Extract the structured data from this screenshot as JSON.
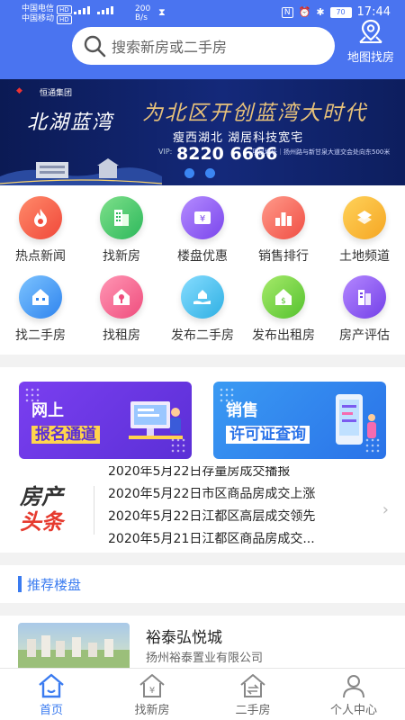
{
  "status_bar": {
    "carrier1": "中国电信",
    "carrier2": "中国移动",
    "hd": "HD",
    "net_sig": "4G",
    "speed_value": "200",
    "speed_unit": "B/s",
    "nfc": "N",
    "battery": "70",
    "time": "17:44"
  },
  "header": {
    "search_placeholder": "搜索新房或二手房",
    "map_label": "地图找房"
  },
  "banner": {
    "logo_brand": "恒通集团",
    "project_name": "北湖蓝湾",
    "slogan": "为北区开创蓝湾大时代",
    "subtitle": "瘦西湖北 湖居科技宽宅",
    "vip_label": "VIP:",
    "phone": "8220 6666",
    "address": "项目地址｜扬州路与新甘泉大道交会处向东500米",
    "page_indicators": 2
  },
  "quick_menu": {
    "items": [
      {
        "label": "热点新闻",
        "icon": "fire-icon",
        "color": "#f45c4a"
      },
      {
        "label": "找新房",
        "icon": "building-icon",
        "color": "#39c76a"
      },
      {
        "label": "楼盘优惠",
        "icon": "discount-tag-icon",
        "color": "#8f5cf0"
      },
      {
        "label": "销售排行",
        "icon": "ranking-icon",
        "color": "#f66a58"
      },
      {
        "label": "土地频道",
        "icon": "land-grid-icon",
        "color": "#f7b335"
      },
      {
        "label": "找二手房",
        "icon": "house-icon",
        "color": "#3a92f3"
      },
      {
        "label": "找租房",
        "icon": "key-house-icon",
        "color": "#f35d8a"
      },
      {
        "label": "发布二手房",
        "icon": "hand-house-icon",
        "color": "#3fb9e8"
      },
      {
        "label": "发布出租房",
        "icon": "money-house-icon",
        "color": "#6ccc3b"
      },
      {
        "label": "房产评估",
        "icon": "evaluate-icon",
        "color": "#8a52ee"
      }
    ]
  },
  "promo": {
    "card1": {
      "line1": "网上",
      "line2": "报名通道"
    },
    "card2": {
      "line1": "销售",
      "line2": "许可证查询"
    }
  },
  "headlines": {
    "brand_line1": "房产",
    "brand_line2": "头条",
    "items": [
      "2020年5月22日存量房成交播报",
      "2020年5月22日市区商品房成交上涨",
      "2020年5月22日江都区高层成交领先",
      "2020年5月21日江都区商品房成交..."
    ]
  },
  "recommend": {
    "title": "推荐楼盘",
    "item": {
      "name": "裕泰弘悦城",
      "developer": "扬州裕泰置业有限公司"
    }
  },
  "bottom_nav": {
    "tabs": [
      {
        "label": "首页",
        "active": true
      },
      {
        "label": "找新房",
        "active": false
      },
      {
        "label": "二手房",
        "active": false
      },
      {
        "label": "个人中心",
        "active": false
      }
    ],
    "active_color": "#3a7bf0"
  }
}
